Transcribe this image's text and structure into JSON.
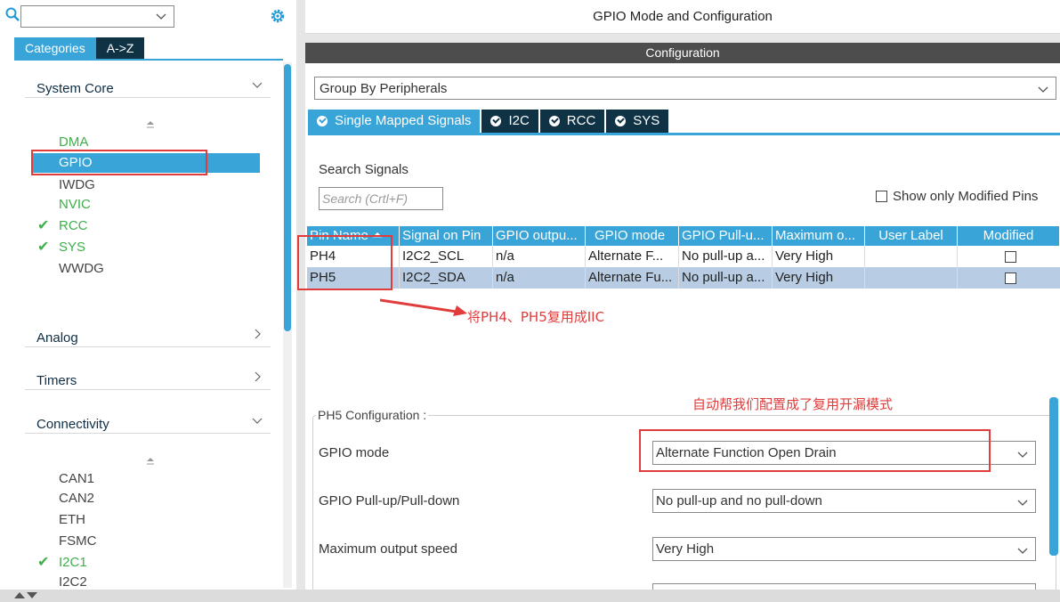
{
  "left": {
    "search": {
      "value": "",
      "placeholder": ""
    },
    "tabs": [
      {
        "label": "Categories"
      },
      {
        "label": "A->Z"
      }
    ],
    "sections": {
      "system_core": {
        "label": "System Core"
      },
      "analog": {
        "label": "Analog"
      },
      "timers": {
        "label": "Timers"
      },
      "connectivity": {
        "label": "Connectivity"
      }
    },
    "system_core_items": [
      {
        "label": "DMA",
        "state": "green"
      },
      {
        "label": "GPIO",
        "state": "selected"
      },
      {
        "label": "IWDG",
        "state": "normal"
      },
      {
        "label": "NVIC",
        "state": "green"
      },
      {
        "label": "RCC",
        "state": "checked"
      },
      {
        "label": "SYS",
        "state": "checked"
      },
      {
        "label": "WWDG",
        "state": "normal"
      }
    ],
    "connectivity_items": [
      {
        "label": "CAN1",
        "state": "normal"
      },
      {
        "label": "CAN2",
        "state": "normal"
      },
      {
        "label": "ETH",
        "state": "normal"
      },
      {
        "label": "FSMC",
        "state": "normal"
      },
      {
        "label": "I2C1",
        "state": "checked"
      },
      {
        "label": "I2C2",
        "state": "normal"
      }
    ]
  },
  "right": {
    "title": "GPIO Mode and Configuration",
    "config_bar": "Configuration",
    "group_by": "Group By Peripherals",
    "signal_tabs": [
      {
        "label": "Single Mapped Signals"
      },
      {
        "label": "I2C"
      },
      {
        "label": "RCC"
      },
      {
        "label": "SYS"
      }
    ],
    "search_label": "Search Signals",
    "search_placeholder": "Search (Crtl+F)",
    "show_modified_label": "Show only Modified Pins",
    "table": {
      "headers": [
        "Pin Name",
        "Signal on Pin",
        "GPIO outpu...",
        "GPIO mode",
        "GPIO Pull-u...",
        "Maximum o...",
        "User Label",
        "Modified"
      ],
      "rows": [
        [
          "PH4",
          "I2C2_SCL",
          "n/a",
          "Alternate F...",
          "No pull-up a...",
          "Very High",
          ""
        ],
        [
          "PH5",
          "I2C2_SDA",
          "n/a",
          "Alternate Fu...",
          "No pull-up a...",
          "Very High",
          ""
        ]
      ]
    },
    "annotation_pins": "将PH4、PH5复用成IIC",
    "annotation_mode": "自动帮我们配置成了复用开漏模式",
    "ph5": {
      "title": "PH5 Configuration :",
      "props": [
        {
          "label": "GPIO mode",
          "value": "Alternate Function Open Drain"
        },
        {
          "label": "GPIO Pull-up/Pull-down",
          "value": "No pull-up and no pull-down"
        },
        {
          "label": "Maximum output speed",
          "value": "Very High"
        }
      ]
    }
  },
  "colors": {
    "accent": "#39a4d8",
    "dark_tab": "#0f3245",
    "annotation_red": "#e03c3c",
    "enabled_green": "#3fae4b",
    "selected_row": "#b8cde4"
  }
}
